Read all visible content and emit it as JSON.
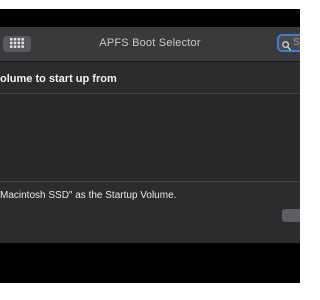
{
  "window": {
    "title": "APFS Boot Selector"
  },
  "toolbar": {
    "view_button_icon": "grid-icon",
    "search": {
      "placeholder": "Se",
      "icon": "search-icon"
    }
  },
  "main": {
    "heading": "olume to start up from"
  },
  "footer": {
    "status": "Macintosh SSD\" as the Startup Volume."
  },
  "colors": {
    "window_bg": "#2a2a2c",
    "titlebar_bg": "#3a3a3c",
    "search_focus_ring": "#3f7ecf",
    "text_primary": "#f2f2f4",
    "text_secondary": "#c9c9cc"
  }
}
